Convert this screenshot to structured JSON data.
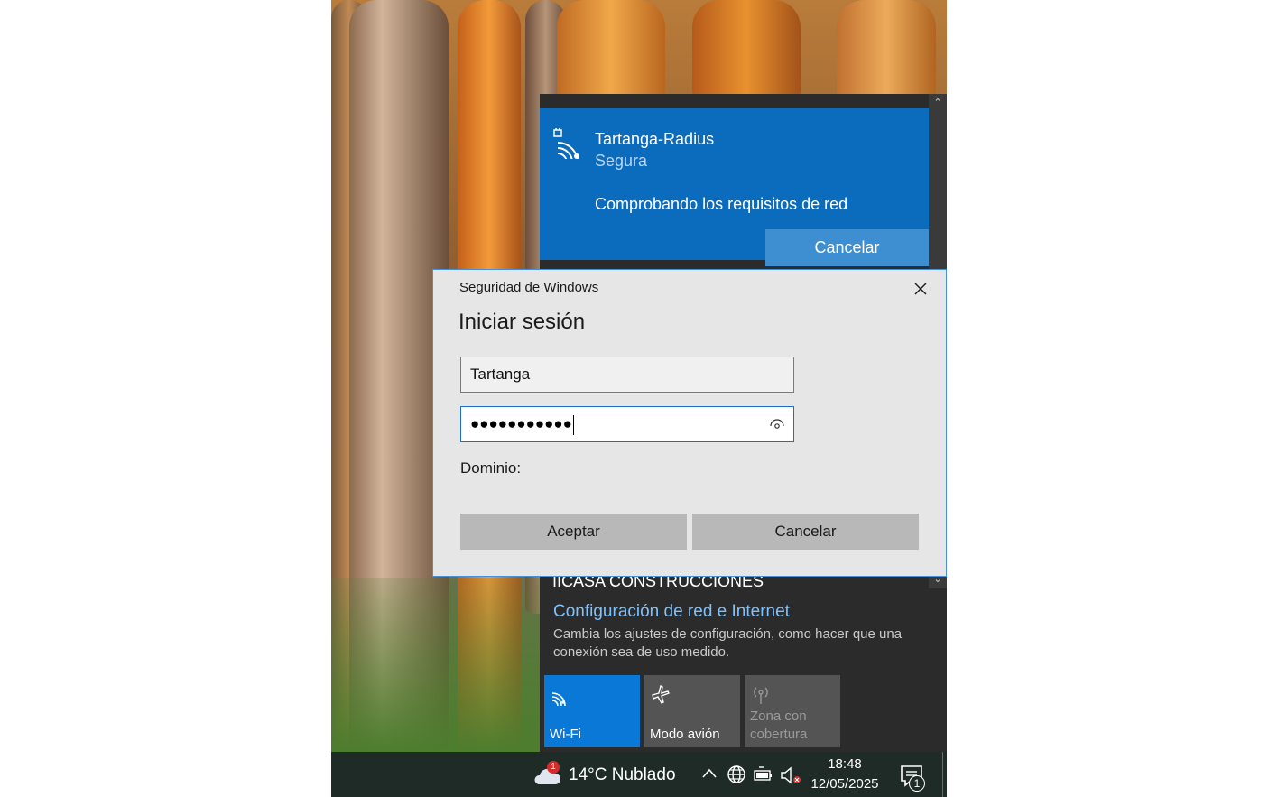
{
  "network_flyout": {
    "scroll_up": "⌃",
    "scroll_down": "⌄",
    "active_network": {
      "name": "Tartanga-Radius",
      "status": "Segura",
      "message": "Comprobando los requisitos de red",
      "cancel_label": "Cancelar"
    },
    "other_network_name": "IICASA CONSTRUCCIONES",
    "settings_link": "Configuración de red e Internet",
    "settings_description": "Cambia los ajustes de configuración, como hacer que una conexión sea de uso medido.",
    "quick_actions": [
      {
        "label": "Wi-Fi",
        "icon": "wifi-icon",
        "state": "on"
      },
      {
        "label": "Modo avión",
        "icon": "airplane-icon",
        "state": "off"
      },
      {
        "label": "Zona con cobertura",
        "icon": "hotspot-icon",
        "state": "disabled"
      }
    ]
  },
  "dialog": {
    "window_title": "Seguridad de Windows",
    "heading": "Iniciar sesión",
    "username_value": "Tartanga",
    "password_masked": "●●●●●●●●●●●",
    "domain_label": "Dominio:",
    "ok_label": "Aceptar",
    "cancel_label": "Cancelar"
  },
  "taskbar": {
    "weather": {
      "badge": "1",
      "text": "14°C  Nublado"
    },
    "clock": {
      "time": "18:48",
      "date": "12/05/2025"
    },
    "notifications_count": "1"
  },
  "colors": {
    "accent": "#0b6bbd",
    "wifi_tile": "#0a78d7",
    "link": "#7cc2ff",
    "taskbar": "#1f2b27"
  }
}
